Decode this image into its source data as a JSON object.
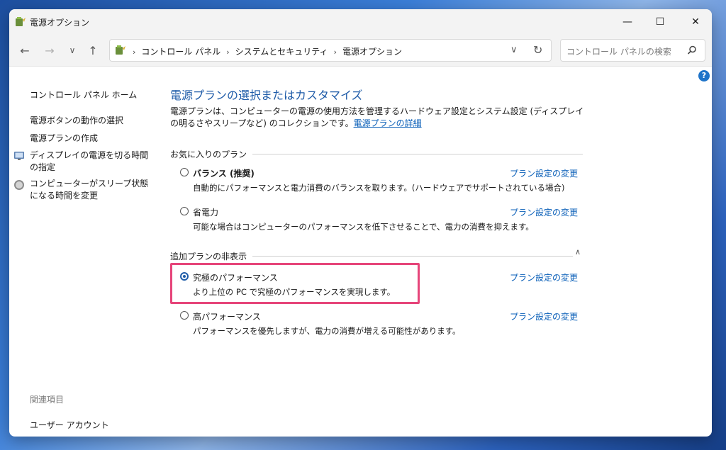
{
  "window": {
    "title": "電源オプション",
    "controls": {
      "minimize": "—",
      "maximize": "☐",
      "close": "✕"
    }
  },
  "nav": {
    "back": "←",
    "forward": "→",
    "recent": "∨",
    "up": "↑",
    "breadcrumbs": [
      "コントロール パネル",
      "システムとセキュリティ",
      "電源オプション"
    ],
    "sep": "›",
    "dropdown": "∨",
    "refresh": "↻",
    "search_placeholder": "コントロール パネルの検索"
  },
  "help": "?",
  "sidebar": {
    "home": "コントロール パネル ホーム",
    "links": [
      "電源ボタンの動作の選択",
      "電源プランの作成",
      "ディスプレイの電源を切る時間の指定",
      "コンピューターがスリープ状態になる時間を変更"
    ],
    "related_heading": "関連項目",
    "related_links": [
      "ユーザー アカウント"
    ]
  },
  "main": {
    "heading": "電源プランの選択またはカスタマイズ",
    "description": "電源プランは、コンピューターの電源の使用方法を管理するハードウェア設定とシステム設定 (ディスプレイの明るさやスリープなど) のコレクションです。",
    "detail_link": "電源プランの詳細",
    "favorites_label": "お気に入りのプラン",
    "hidden_label": "追加プランの非表示",
    "change_link": "プラン設定の変更",
    "plans": [
      {
        "name": "バランス (推奨)",
        "desc": "自動的にパフォーマンスと電力消費のバランスを取ります。(ハードウェアでサポートされている場合)",
        "selected": false
      },
      {
        "name": "省電力",
        "desc": "可能な場合はコンピューターのパフォーマンスを低下させることで、電力の消費を抑えます。",
        "selected": false
      },
      {
        "name": "究極のパフォーマンス",
        "desc": "より上位の PC で究極のパフォーマンスを実現します。",
        "selected": true
      },
      {
        "name": "高パフォーマンス",
        "desc": "パフォーマンスを優先しますが、電力の消費が増える可能性があります。",
        "selected": false
      }
    ]
  },
  "colors": {
    "accent": "#1e5ba8",
    "link": "#0a5fb8",
    "highlight": "#e6457a"
  }
}
